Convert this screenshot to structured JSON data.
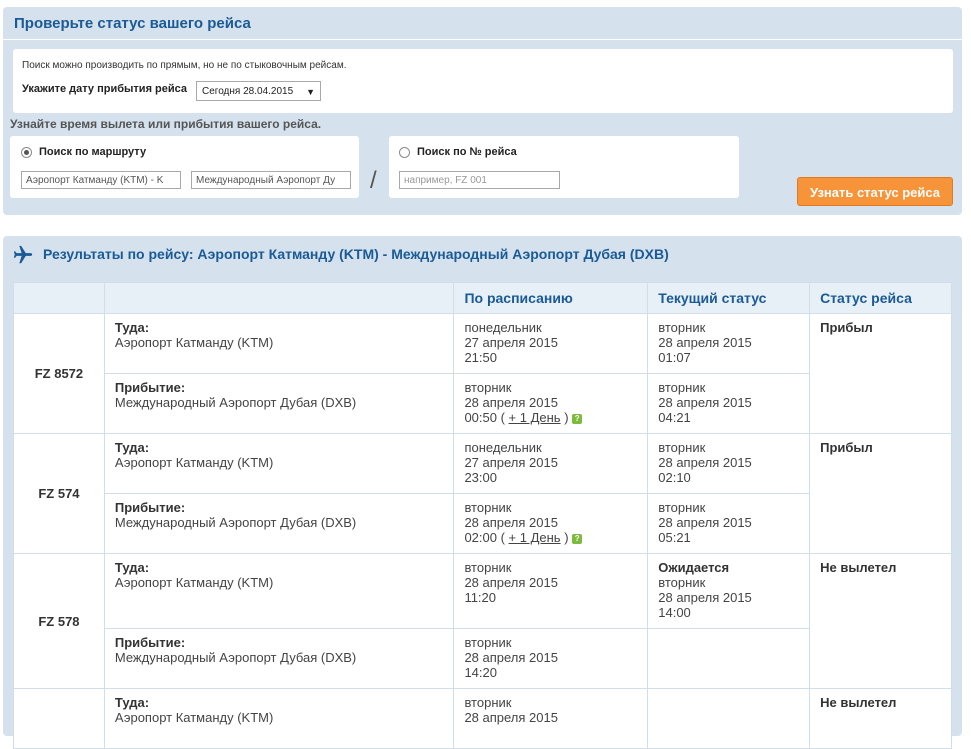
{
  "search": {
    "title": "Проверьте статус вашего рейса",
    "hint": "Поиск можно производить по прямым, но не по стыковочным рейсам.",
    "date_label": "Укажите дату прибытия рейса",
    "date_value": "Сегодня 28.04.2015",
    "sub_label": "Узнайте время вылета или прибытия вашего рейса.",
    "route_option": "Поиск по маршруту",
    "from_value": "Аэропорт Катманду (KTM) - K",
    "to_value": "Международный Аэропорт Ду",
    "slash": "/",
    "flight_option": "Поиск по № рейса",
    "flight_placeholder": "например, FZ 001",
    "button": "Узнать статус рейса"
  },
  "results": {
    "title": "Результаты по рейсу: Аэропорт Катманду (KTM) - Международный Аэропорт Дубая (DXB)",
    "headers": [
      "",
      "",
      "По расписанию",
      "Текущий статус",
      "Статус рейса"
    ],
    "dep_label": "Туда:",
    "arr_label": "Прибытие:",
    "flights": [
      {
        "num": "FZ 8572",
        "dep_airport": "Аэропорт Катманду (KTM)",
        "dep_sched": [
          "понедельник",
          "27 апреля 2015",
          "21:50"
        ],
        "dep_current": [
          "вторник",
          "28 апреля 2015",
          "01:07"
        ],
        "arr_airport": "Международный Аэропорт Дубая (DXB)",
        "arr_sched": [
          "вторник",
          "28 апреля 2015",
          "00:50"
        ],
        "arr_plus": "+ 1 День",
        "arr_current": [
          "вторник",
          "28 апреля 2015",
          "04:21"
        ],
        "status": "Прибыл"
      },
      {
        "num": "FZ 574",
        "dep_airport": "Аэропорт Катманду (KTM)",
        "dep_sched": [
          "понедельник",
          "27 апреля 2015",
          "23:00"
        ],
        "dep_current": [
          "вторник",
          "28 апреля 2015",
          "02:10"
        ],
        "arr_airport": "Международный Аэропорт Дубая (DXB)",
        "arr_sched": [
          "вторник",
          "28 апреля 2015",
          "02:00"
        ],
        "arr_plus": "+ 1 День",
        "arr_current": [
          "вторник",
          "28 апреля 2015",
          "05:21"
        ],
        "status": "Прибыл"
      },
      {
        "num": "FZ 578",
        "dep_airport": "Аэропорт Катманду (KTM)",
        "dep_sched": [
          "вторник",
          "28 апреля 2015",
          "11:20"
        ],
        "dep_current_status": "Ожидается",
        "dep_current": [
          "вторник",
          "28 апреля 2015",
          "14:00"
        ],
        "arr_airport": "Международный Аэропорт Дубая (DXB)",
        "arr_sched": [
          "вторник",
          "28 апреля 2015",
          "14:20"
        ],
        "status": "Не вылетел"
      },
      {
        "dep_airport": "Аэропорт Катманду (KTM)",
        "dep_sched": [
          "вторник",
          "28 апреля 2015"
        ],
        "status": "Не вылетел"
      }
    ]
  }
}
